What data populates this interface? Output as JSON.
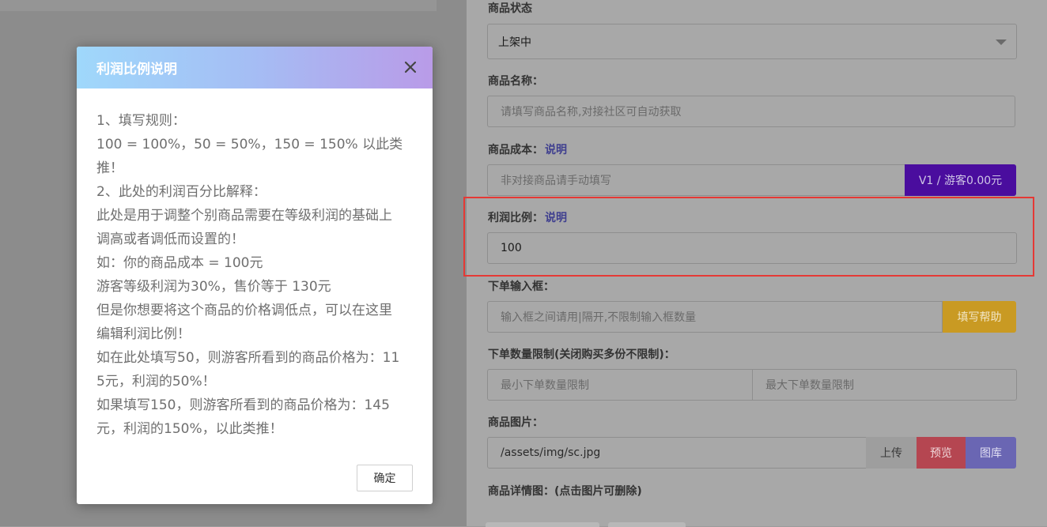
{
  "form": {
    "status": {
      "label": "商品状态",
      "selected": "上架中"
    },
    "name": {
      "label": "商品名称：",
      "placeholder": "请填写商品名称,对接社区可自动获取"
    },
    "cost": {
      "label": "商品成本：",
      "link": "说明",
      "placeholder": "非对接商品请手动填写",
      "addon": "V1 / 游客0.00元"
    },
    "profit": {
      "label": "利润比例：",
      "link": "说明",
      "value": "100"
    },
    "order_input": {
      "label": "下单输入框：",
      "placeholder": "输入框之间请用|隔开,不限制输入框数量",
      "help_button": "填写帮助"
    },
    "quantity_limit": {
      "label": "下单数量限制(关闭购买多份不限制)：",
      "min_placeholder": "最小下单数量限制",
      "max_placeholder": "最大下单数量限制"
    },
    "image": {
      "label": "商品图片：",
      "value": "/assets/img/sc.jpg",
      "upload_button": "上传",
      "preview_button": "预览",
      "gallery_button": "图库"
    },
    "detail_images": {
      "label": "商品详情图：(点击图片可删除)"
    }
  },
  "modal": {
    "title": "利润比例说明",
    "lines": [
      "1、填写规则：",
      "100 = 100%，50 = 50%，150 = 150% 以此类",
      "推！",
      "2、此处的利润百分比解释：",
      "此处是用于调整个别商品需要在等级利润的基础上",
      "调高或者调低而设置的！",
      "如：你的商品成本 = 100元",
      "游客等级利润为30%，售价等于 130元",
      "但是你想要将这个商品的价格调低点，可以在这里",
      "编辑利润比例！",
      "如在此处填写50，则游客所看到的商品价格为：11",
      "5元，利润的50%！",
      "如果填写150，则游客所看到的商品价格为：145",
      "元，利润的150%，以此类推！"
    ],
    "ok_button": "确定"
  },
  "colors": {
    "cost_addon": "#4a0d9e",
    "help_button": "#c99a23",
    "upload_button": "#9e9e9e",
    "preview_button": "#b54651",
    "gallery_button": "#6a66b3",
    "highlight": "#e53935"
  }
}
